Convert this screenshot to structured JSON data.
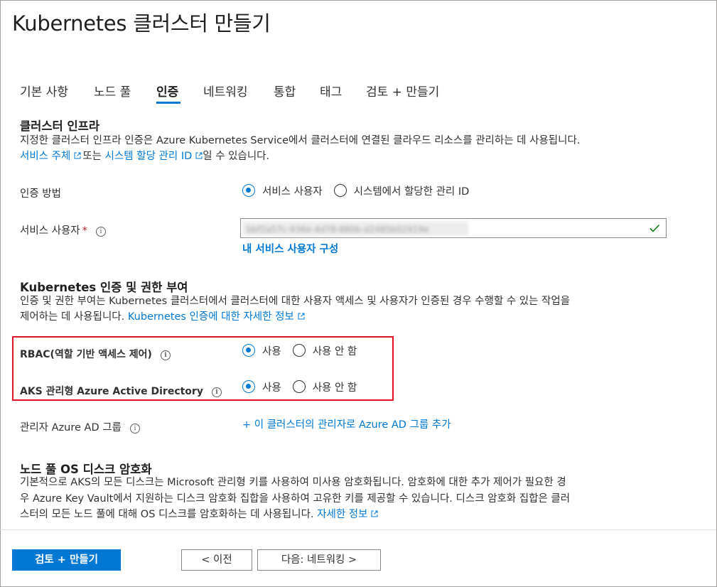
{
  "page_title": "Kubernetes 클러스터 만들기",
  "tabs": [
    {
      "label": "기본 사항"
    },
    {
      "label": "노드 풀"
    },
    {
      "label": "인증"
    },
    {
      "label": "네트워킹"
    },
    {
      "label": "통합"
    },
    {
      "label": "태그"
    },
    {
      "label": "검토 + 만들기"
    }
  ],
  "active_tab": "인증",
  "cluster_infra": {
    "heading": "클러스터 인프라",
    "desc_line1": "지정한 클러스터 인프라 인증은 Azure Kubernetes Service에서 클러스터에 연결된 클라우드 리소스를 관리하는 데 사용됩니다.",
    "link_sp": "서비스 주체",
    "or_text": "또는",
    "link_mi": "시스템 할당 관리 ID",
    "desc_tail": "일 수 있습니다."
  },
  "auth_method": {
    "label": "인증 방법",
    "options": [
      "서비스 사용자",
      "시스템에서 할당한 관리 ID"
    ],
    "selected": "서비스 사용자"
  },
  "service_principal": {
    "label": "서비스 사용자",
    "required_mark": "*",
    "value": "bbf2a57c-936e-4d78-880b-d2485b02919e",
    "configure_link": "내 서비스 사용자 구성"
  },
  "k8s_auth": {
    "heading": "Kubernetes 인증 및 권한 부여",
    "desc_line1": "인증 및 권한 부여는 Kubernetes 클러스터에서 클러스터에 대한 사용자 액세스 및 사용자가 인증된 경우 수행할 수 있는 작업을",
    "desc_line2": "제어하는 데 사용됩니다.",
    "learn_more": "Kubernetes 인증에 대한 자세한 정보"
  },
  "rbac": {
    "label": "RBAC(역할 기반 액세스 제어)",
    "options": [
      "사용",
      "사용 안 함"
    ],
    "selected": "사용"
  },
  "aad": {
    "label": "AKS 관리형 Azure Active Directory",
    "options": [
      "사용",
      "사용 안 함"
    ],
    "selected": "사용"
  },
  "admin_group": {
    "label": "관리자 Azure AD 그룹",
    "add_link": "+ 이 클러스터의 관리자로 Azure AD 그룹 추가"
  },
  "disk_encryption": {
    "heading": "노드 풀 OS 디스크 암호화",
    "line1": "기본적으로 AKS의 모든 디스크는 Microsoft 관리형 키를 사용하여 미사용 암호화됩니다. 암호화에 대한 추가 제어가 필요한 경",
    "line2": "우 Azure Key Vault에서 지원하는 디스크 암호화 집합을 사용하여 고유한 키를 제공할 수 있습니다. 디스크 암호화 집합은 클러",
    "line3": "스터의 모든 노드 풀에 대해 OS 디스크를 암호화하는 데 사용됩니다.",
    "learn_more": "자세한 정보"
  },
  "footer": {
    "review_create": "검토 + 만들기",
    "previous": "< 이전",
    "next": "다음: 네트워킹 >"
  },
  "colors": {
    "accent": "#0078d4",
    "highlight_box": "#e81123",
    "valid_check": "#107c10"
  }
}
